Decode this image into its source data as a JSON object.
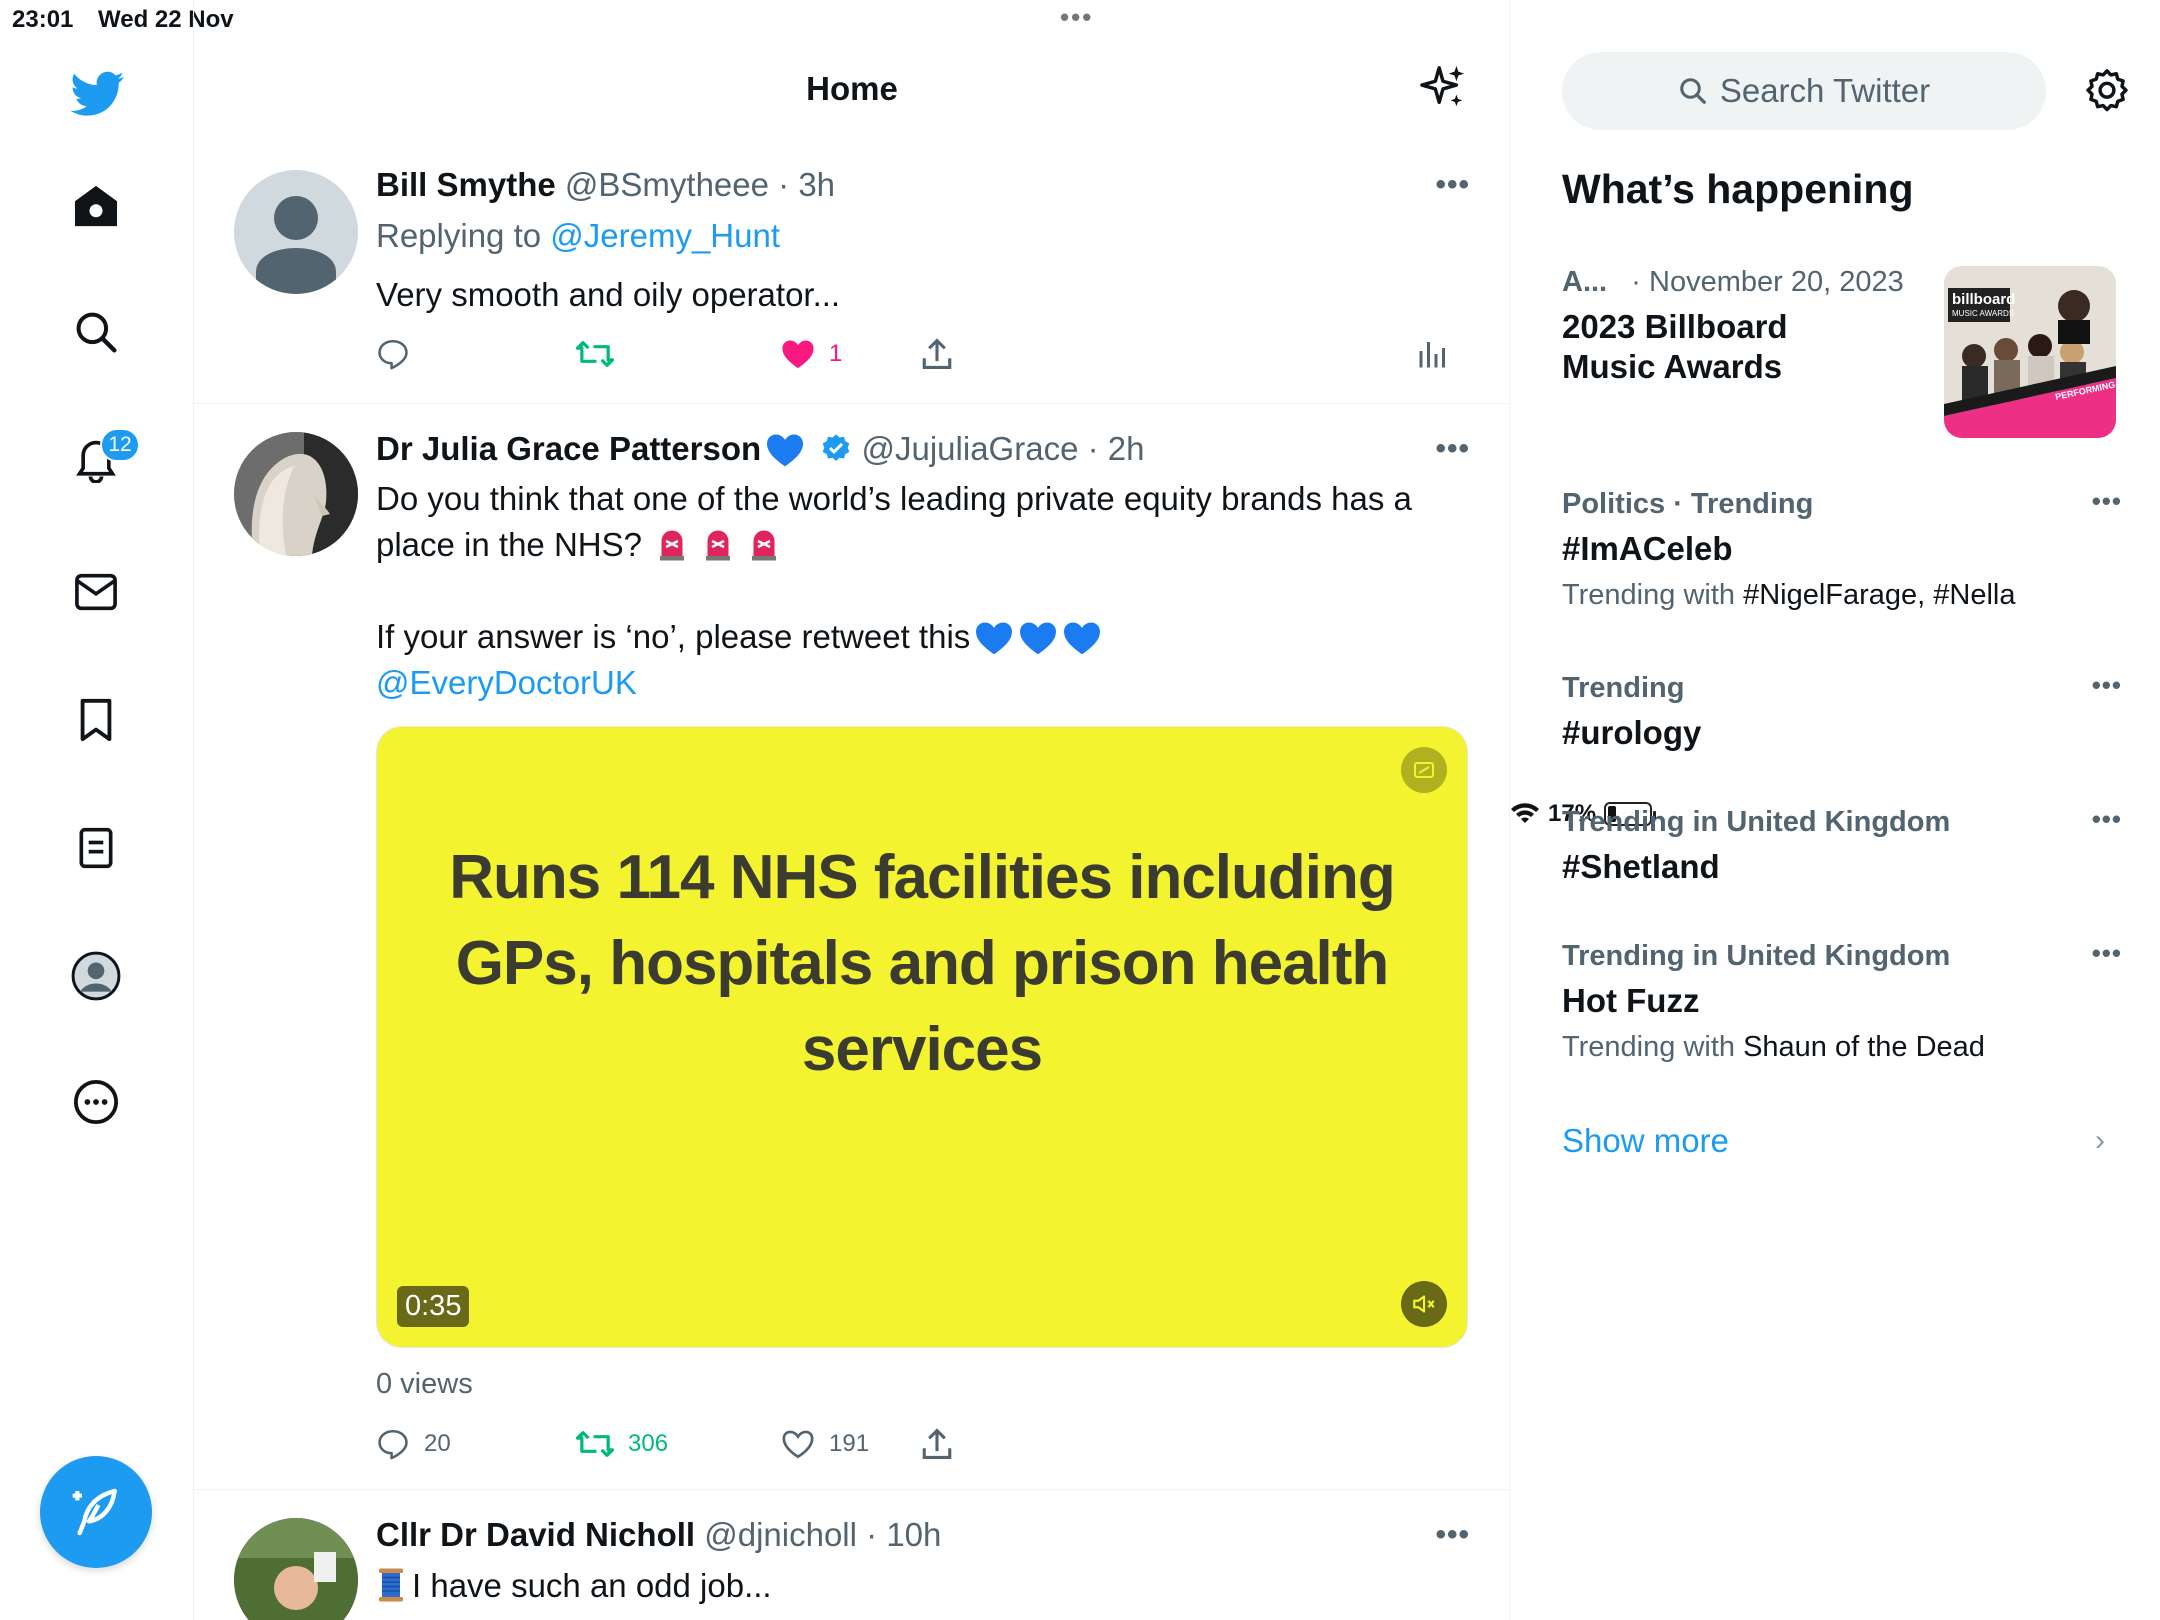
{
  "status_bar": {
    "time": "23:01",
    "date": "Wed 22 Nov",
    "multitask_dots": "•••",
    "battery": "17%"
  },
  "nav": {
    "items": [
      "twitter-logo",
      "home",
      "explore",
      "notifications",
      "messages",
      "bookmarks",
      "lists",
      "profile",
      "more"
    ],
    "notifications_badge": "12"
  },
  "header": {
    "title": "Home"
  },
  "tweets": [
    {
      "name": "Bill Smythe",
      "handle": "@BSmytheee",
      "time": "· 3h",
      "reply_prefix": "Replying to ",
      "reply_to": "@Jeremy_Hunt",
      "text": "Very smooth and oily operator...",
      "likes": "1",
      "more": "•••"
    },
    {
      "name": "Dr Julia Grace Patterson",
      "handle": "@JujuliaGrace",
      "time": "· 2h",
      "text_line1": "Do you think that one of the world’s leading private equity brands has a",
      "text_line2": "place in the NHS?",
      "text_line3": "If your answer is ‘no’, please retweet this",
      "mention": "@EveryDoctorUK",
      "media_text": "Runs 114 NHS facilities including GPs, hospitals and prison health services",
      "duration": "0:35",
      "views": "0 views",
      "replies": "20",
      "retweets": "306",
      "likes": "191",
      "more": "•••"
    },
    {
      "name": "Cllr Dr David Nicholl",
      "handle": "@djnicholl",
      "time": "· 10h",
      "text": "I have such an odd job...",
      "more": "•••"
    }
  ],
  "sidebar": {
    "search_placeholder": "Search Twitter",
    "title": "What’s happening",
    "featured": {
      "category": "A...",
      "date": "· November 20, 2023",
      "title_line1": "2023 Billboard",
      "title_line2": "Music Awards",
      "thumb_logo": "billboard",
      "thumb_sub": "MUSIC AWARDS",
      "thumb_tag": "PERFORMING"
    },
    "trends": [
      {
        "category": "Politics · Trending",
        "title": "#ImACeleb",
        "with_prefix": "Trending with ",
        "with": "#NigelFarage, #Nella"
      },
      {
        "category": "Trending",
        "title": "#urology"
      },
      {
        "category": "Trending in United Kingdom",
        "title": "#Shetland"
      },
      {
        "category": "Trending in United Kingdom",
        "title": "Hot Fuzz",
        "with_prefix": "Trending with ",
        "with": "Shaun of the Dead"
      }
    ],
    "show_more": "Show more"
  },
  "colors": {
    "accent": "#1d9bf0",
    "retweet": "#00ba7c",
    "like": "#f91880",
    "media_bg": "#f3f32f"
  }
}
